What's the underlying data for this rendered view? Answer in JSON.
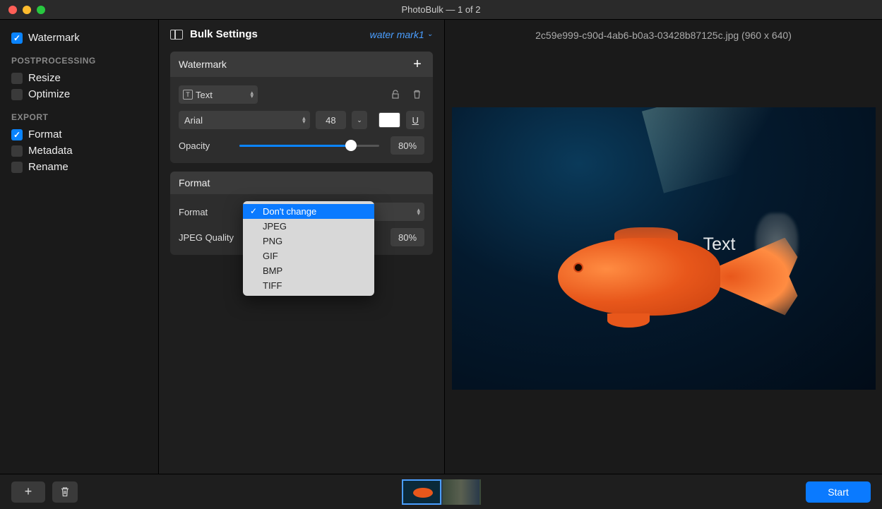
{
  "titlebar": {
    "title": "PhotoBulk — 1 of 2"
  },
  "sidebar": {
    "watermark": {
      "label": "Watermark",
      "checked": true
    },
    "postprocessing_header": "POSTPROCESSING",
    "resize": {
      "label": "Resize",
      "checked": false
    },
    "optimize": {
      "label": "Optimize",
      "checked": false
    },
    "export_header": "EXPORT",
    "format": {
      "label": "Format",
      "checked": true
    },
    "metadata": {
      "label": "Metadata",
      "checked": false
    },
    "rename": {
      "label": "Rename",
      "checked": false
    }
  },
  "settings": {
    "title": "Bulk Settings",
    "preset": "water mark1",
    "watermark_panel": {
      "title": "Watermark",
      "type": "Text",
      "font": "Arial",
      "size": "48",
      "color": "#ffffff",
      "underline_label": "U",
      "opacity_label": "Opacity",
      "opacity_value": "80%",
      "opacity_fill": 80
    },
    "format_panel": {
      "title": "Format",
      "format_label": "Format",
      "quality_label": "JPEG Quality",
      "quality_value": "80%",
      "dropdown_open": true,
      "dropdown_selected": "Don't change",
      "dropdown_options": [
        "Don't change",
        "JPEG",
        "PNG",
        "GIF",
        "BMP",
        "TIFF"
      ]
    }
  },
  "preview": {
    "filename": "2c59e999-c90d-4ab6-b0a3-03428b87125c.jpg (960 x 640)",
    "watermark_text": "Text"
  },
  "bottombar": {
    "start_label": "Start"
  }
}
